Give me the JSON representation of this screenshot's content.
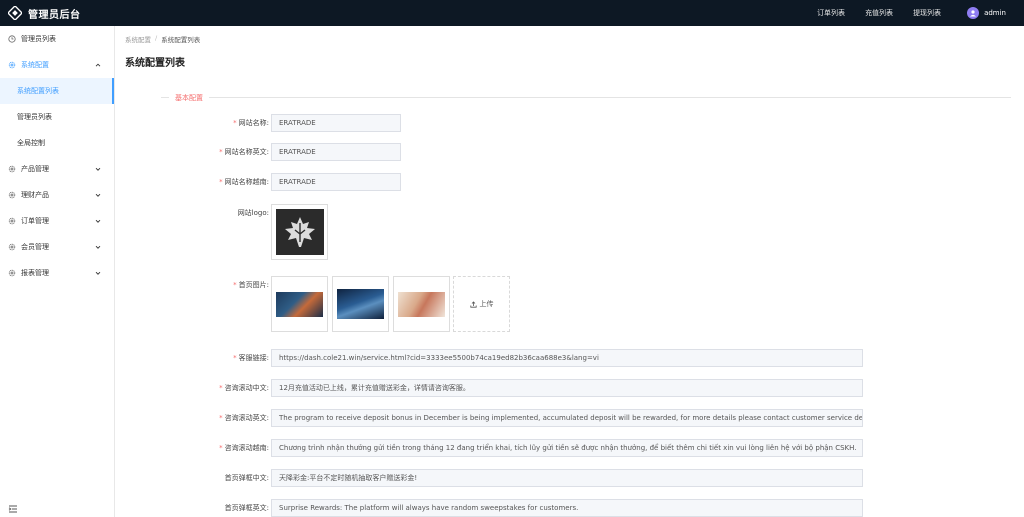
{
  "app": {
    "title": "管理员后台"
  },
  "topnav": {
    "items": [
      "订单列表",
      "充值列表",
      "提现列表"
    ],
    "username": "admin"
  },
  "sidebar": {
    "items": [
      {
        "label": "管理员列表",
        "icon": "clock-icon"
      },
      {
        "label": "系统配置",
        "icon": "gear-icon",
        "expanded": true,
        "children": [
          "系统配置列表",
          "管理员列表",
          "全局控制"
        ]
      },
      {
        "label": "产品管理",
        "icon": "gear-icon"
      },
      {
        "label": "理财产品",
        "icon": "gear-icon"
      },
      {
        "label": "订单管理",
        "icon": "gear-icon"
      },
      {
        "label": "会员管理",
        "icon": "gear-icon"
      },
      {
        "label": "报表管理",
        "icon": "gear-icon"
      }
    ]
  },
  "breadcrumb": {
    "parent": "系统配置",
    "separator": "/",
    "current": "系统配置列表"
  },
  "page": {
    "title": "系统配置列表"
  },
  "section": {
    "title": "基本配置"
  },
  "form": {
    "site_name": {
      "label": "网站名称:",
      "value": "ERATRADE",
      "required": true
    },
    "site_name_en": {
      "label": "网站名称英文:",
      "value": "ERATRADE",
      "required": true
    },
    "site_name_vi": {
      "label": "网站名称越南:",
      "value": "ERATRADE",
      "required": true
    },
    "site_logo": {
      "label": "网站logo:"
    },
    "home_images": {
      "label": "首页图片:",
      "required": true,
      "upload_label": "上传"
    },
    "service_link": {
      "label": "客服链接:",
      "value": "https://dash.cole21.win/service.html?cid=3333ee5500b74ca19ed82b36caa688e3&lang=vi",
      "required": true
    },
    "scroll_zh": {
      "label": "咨询滚动中文:",
      "value": "12月充值活动已上线，累计充值赠送彩金，详情请咨询客服。",
      "required": true
    },
    "scroll_en": {
      "label": "咨询滚动英文:",
      "value": "The program to receive deposit bonus in December is being implemented, accumulated deposit will be rewarded, for more details please contact customer service departmen",
      "required": true
    },
    "scroll_vi": {
      "label": "咨询滚动越南:",
      "value": "Chương trình nhận thưởng gửi tiền trong tháng 12 đang triển khai, tích lũy gửi tiền sẽ được nhận thưởng, để biết thêm chi tiết xin vui lòng liên hệ với bộ phận CSKH.",
      "required": true
    },
    "banner_zh": {
      "label": "首页弹框中文:",
      "value": "天降彩金:平台不定时随机抽取客户赠送彩金!"
    },
    "banner_en": {
      "label": "首页弹框英文:",
      "value": "Surprise Rewards: The platform will always have random sweepstakes for customers."
    }
  },
  "colors": {
    "topbar": "#0d1824",
    "accent": "#409eff",
    "required": "#f56c6c"
  }
}
